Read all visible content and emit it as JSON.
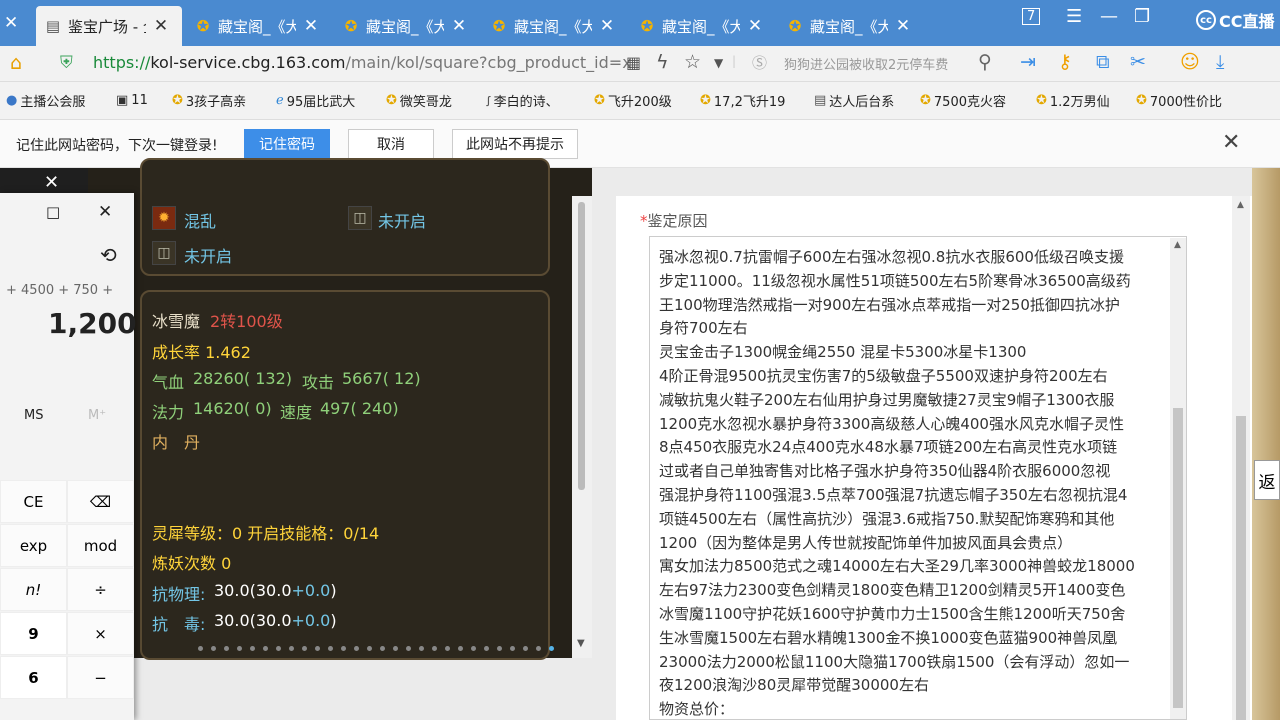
{
  "tabs": [
    {
      "label": "鉴宝广场 - 全",
      "active": true
    },
    {
      "label": "藏宝阁_《大"
    },
    {
      "label": "藏宝阁_《大"
    },
    {
      "label": "藏宝阁_《大"
    },
    {
      "label": "藏宝阁_《大"
    },
    {
      "label": "藏宝阁_《大"
    }
  ],
  "window": {
    "badge": "7",
    "brand": "CC直播"
  },
  "address": {
    "scheme": "https://",
    "host": "kol-service.cbg.163.com",
    "path": "/main/kol/square?cbg_product_id=x",
    "search_hint": "狗狗进公园被收取2元停车费"
  },
  "bookmarks": [
    "主播公会服",
    "11",
    "3孩子高亲",
    "95届比武大",
    "微笑哥龙",
    "李白的诗、",
    "飞升200级",
    "17,2飞升19",
    "达人后台系",
    "7500克火容",
    "1.2万男仙",
    "7000性价比"
  ],
  "password_bar": {
    "message": "记住此网站密码，下次一键登录!",
    "remember": "记住密码",
    "cancel": "取消",
    "never": "此网站不再提示"
  },
  "game": {
    "skill1": "混乱",
    "locked1": "未开启",
    "locked2": "未开启",
    "pet_name": "冰雪魔",
    "pet_level": "2转100级",
    "growth": "成长率 1.462",
    "hp_label": "气血",
    "hp": "28260( 132)",
    "atk_label": "攻击",
    "atk": "5667( 12)",
    "mp_label": "法力",
    "mp": "14620( 0)",
    "spd_label": "速度",
    "spd": "497( 240)",
    "inner": "内　丹",
    "lingxi": "灵犀等级：0  开启技能格：0/14",
    "lianyao": "炼妖次数 0",
    "res1_label": "抗物理:",
    "res1_base": "30.0(30.0",
    "res1_bonus": "+0.0",
    "res1_end": ")",
    "res2_label": "抗　毒:",
    "res2_base": "30.0(30.0",
    "res2_bonus": "+0.0",
    "res2_end": ")"
  },
  "calculator": {
    "expression": "+ 4500 + 750 +",
    "result": "1,200",
    "ms": "MS",
    "mplus": "M⁺",
    "keys": [
      [
        "CE",
        "⌫"
      ],
      [
        "exp",
        "mod"
      ],
      [
        "n!",
        "÷"
      ],
      [
        "9",
        "×"
      ],
      [
        "6",
        "−"
      ]
    ]
  },
  "form": {
    "label": "鉴定原因",
    "lines": [
      "强冰忽视0.7抗雷帽子600左右强冰忽视0.8抗水衣服600低级召唤支援",
      "步定11000。11级忽视水属性51项链500左右5阶寒骨冰36500高级药",
      "王100物理浩然戒指一对900左右强冰点萃戒指一对250抵御四抗冰护",
      "身符700左右",
      "灵宝金击子1300幌金绳2550 混星卡5300冰星卡1300",
      "4阶正骨混9500抗灵宝伤害7的5级敏盘子5500双速护身符200左右",
      "减敏抗鬼火鞋子200左右仙用护身过男魔敏捷27灵宝9帽子1300衣服",
      "1200克水忽视水暴护身符3300高级慈人心魄400强水风克水帽子灵性",
      "8点450衣服克水24点400克水48水暴7项链200左右高灵性克水项链",
      "过或者自己单独寄售对比格子强水护身符350仙器4阶衣服6000忽视",
      "强混护身符1100强混3.5点萃700强混7抗遗忘帽子350左右忽视抗混4",
      "项链4500左右（属性高抗沙）强混3.6戒指750.默契配饰寒鸦和其他",
      "1200（因为整体是男人传世就按配饰单件加披风面具会贵点）",
      "寓女加法力8500范式之魂14000左右大圣29几率3000神兽蛟龙18000",
      "左右97法力2300变色剑精灵1800变色精卫1200剑精灵5开1400变色",
      "冰雪魔1100守护花妖1600守护黄巾力士1500含生熊1200听天750舍",
      "生冰雪魔1500左右碧水精魄1300金不换1000变色蓝猫900神兽凤凰",
      "23000法力2000松鼠1100大隐猫1700铁扇1500（会有浮动）忽如一",
      "夜1200浪淘沙80灵犀带觉醒30000左右",
      "物资总价："
    ]
  },
  "side_tab": "返"
}
